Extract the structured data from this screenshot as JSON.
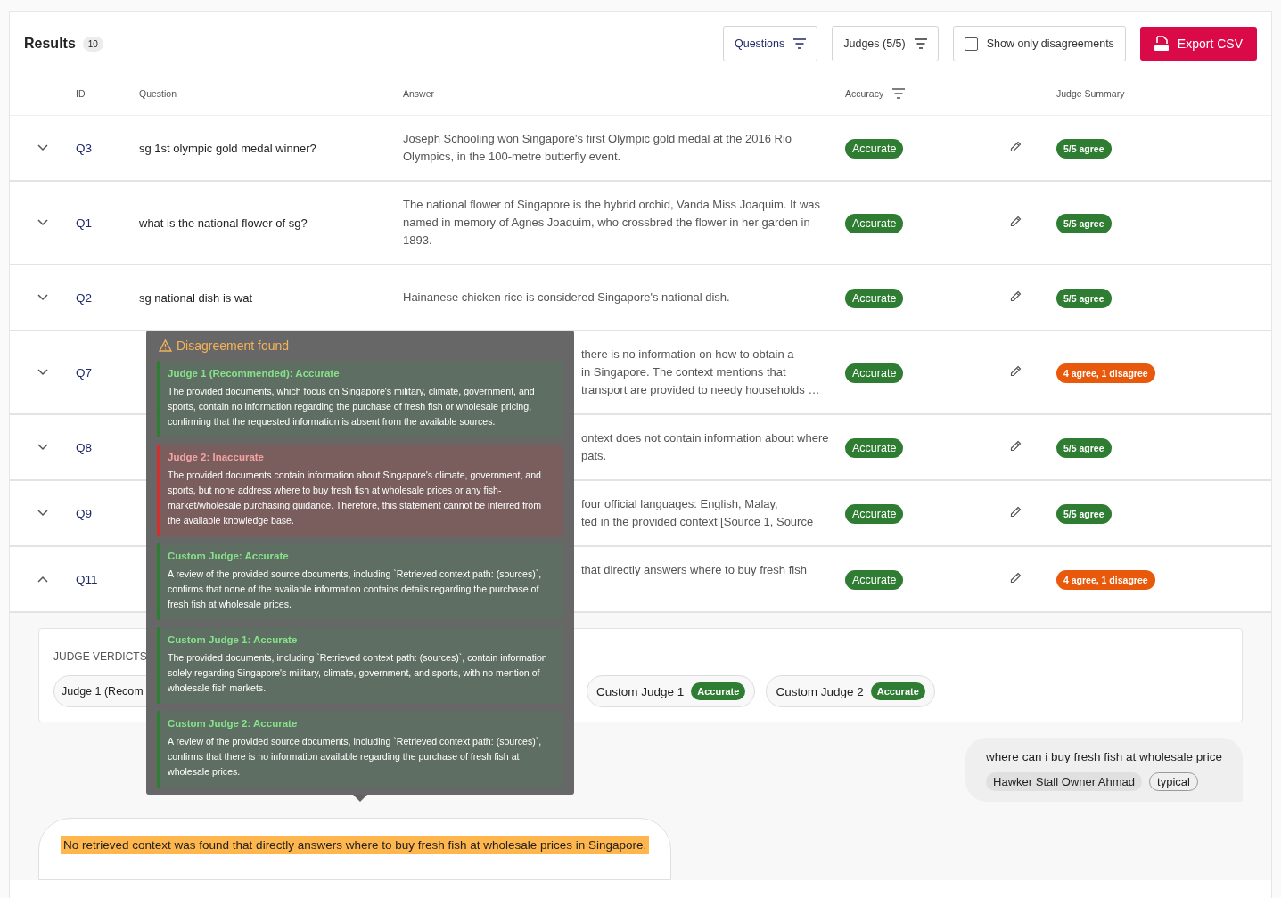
{
  "header": {
    "title": "Results",
    "count": "10",
    "filters": [
      {
        "label": "Questions",
        "kind": "link"
      },
      {
        "label": "Judges (5/5)",
        "kind": "plain"
      }
    ],
    "disagreements_toggle": {
      "label": "Show only disagreements",
      "checked": false
    },
    "export_button": "Export CSV"
  },
  "columns": [
    "ID",
    "Question",
    "Answer",
    "Accuracy",
    "Judge Summary"
  ],
  "rows": [
    {
      "id": "Q3",
      "expanded": false,
      "question": "sg 1st olympic gold medal winner?",
      "answer": "Joseph Schooling won Singapore's first Olympic gold medal at the 2016 Rio Olympics, in the 100-metre butterfly event.",
      "accuracy": "Accurate",
      "summary": "5/5 agree",
      "color": "#2e7d32"
    },
    {
      "id": "Q1",
      "expanded": false,
      "question": "what is the national flower of sg?",
      "answer": "The national flower of Singapore is the hybrid orchid, Vanda Miss Joaquim. It was named in memory of Agnes Joaquim, who crossbred the flower in her garden in 1893.",
      "accuracy": "Accurate",
      "summary": "5/5 agree",
      "color": "#2e7d32"
    },
    {
      "id": "Q2",
      "expanded": false,
      "question": "sg national dish is wat",
      "answer": "Hainanese chicken rice is considered Singapore's national dish.",
      "accuracy": "Accurate",
      "summary": "5/5 agree",
      "color": "#2e7d32"
    },
    {
      "id": "Q7",
      "expanded": false,
      "answer_fragment": [
        "there is no information on how to obtain a",
        "in Singapore. The context mentions that",
        "transport are provided to needy households …"
      ],
      "accuracy": "Accurate",
      "summary": "4 agree, 1 disagree",
      "color": "#e8590c"
    },
    {
      "id": "Q8",
      "expanded": false,
      "answer_fragment": [
        "ontext does not contain information about where",
        "pats."
      ],
      "accuracy": "Accurate",
      "summary": "5/5 agree",
      "color": "#2e7d32"
    },
    {
      "id": "Q9",
      "expanded": false,
      "answer_fragment": [
        "four official languages: English, Malay,",
        "ted in the provided context [Source 1, Source"
      ],
      "accuracy": "Accurate",
      "summary": "5/5 agree",
      "color": "#2e7d32"
    },
    {
      "id": "Q11",
      "expanded": true,
      "answer_fragment": [
        "that directly answers where to buy fresh fish"
      ],
      "accuracy": "Accurate",
      "summary": "4 agree, 1 disagree",
      "color": "#e8590c"
    }
  ],
  "verdicts": {
    "title": "JUDGE VERDICTS",
    "chips": [
      {
        "label": "Judge 1 (Recom"
      },
      {
        "label": "Custom Judge 1",
        "verdict": "Accurate",
        "kind": "accurate"
      },
      {
        "label": "Custom Judge 2",
        "verdict": "Accurate",
        "kind": "accurate"
      }
    ]
  },
  "user_message": {
    "text": "where can i buy fresh fish at wholesale price",
    "persona": "Hawker Stall Owner Ahmad",
    "tag": "typical"
  },
  "answer_message": {
    "text": "No retrieved context was found that directly answers where to buy fresh fish at wholesale prices in Singapore.",
    "highlighted": true
  },
  "popup": {
    "title": "Disagreement found",
    "judges": [
      {
        "heading": "Judge 1 (Recommended): Accurate",
        "kind": "accurate",
        "text": "The provided documents, which focus on Singapore's military, climate, government, and sports, contain no information regarding the purchase of fresh fish or wholesale pricing, confirming that the requested information is absent from the available sources."
      },
      {
        "heading": "Judge 2: Inaccurate",
        "kind": "inaccurate",
        "text": "The provided documents contain information about Singapore's climate, government, and sports, but none address where to buy fresh fish at wholesale prices or any fish-market/wholesale purchasing guidance. Therefore, this statement cannot be inferred from the available knowledge base."
      },
      {
        "heading": "Custom Judge: Accurate",
        "kind": "accurate",
        "text": "A review of the provided source documents, including `Retrieved context path: (sources)`, confirms that none of the available information contains details regarding the purchase of fresh fish at wholesale prices."
      },
      {
        "heading": "Custom Judge 1: Accurate",
        "kind": "accurate",
        "text": "The provided documents, including `Retrieved context path: (sources)`, contain information solely regarding Singapore's military, climate, government, and sports, with no mention of wholesale fish markets."
      },
      {
        "heading": "Custom Judge 2: Accurate",
        "kind": "accurate",
        "text": "A review of the provided source documents, including `Retrieved context path: (sources)`, confirms that there is no information available regarding the purchase of fresh fish at wholesale prices."
      }
    ]
  }
}
